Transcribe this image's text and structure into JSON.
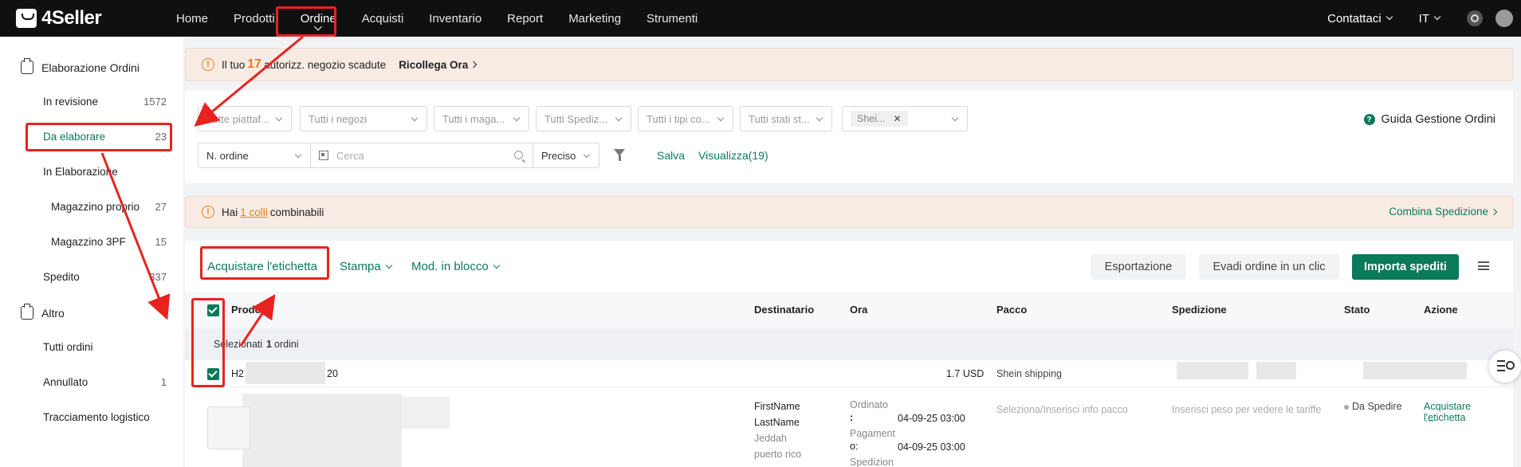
{
  "app": {
    "logo": "4Seller"
  },
  "nav": {
    "items": [
      {
        "label": "Home"
      },
      {
        "label": "Prodotti"
      },
      {
        "label": "Ordine"
      },
      {
        "label": "Acquisti"
      },
      {
        "label": "Inventario"
      },
      {
        "label": "Report"
      },
      {
        "label": "Marketing"
      },
      {
        "label": "Strumenti"
      }
    ],
    "contact": "Contattaci",
    "language": "IT"
  },
  "sidebar": {
    "group1": "Elaborazione Ordini",
    "items": [
      {
        "label": "In revisione",
        "count": "1572"
      },
      {
        "label": "Da elaborare",
        "count": "23"
      },
      {
        "label": "In Elaborazione",
        "count": ""
      },
      {
        "label": "Magazzino proprio",
        "count": "27"
      },
      {
        "label": "Magazzino 3PF",
        "count": "15"
      },
      {
        "label": "Spedito",
        "count": "337"
      }
    ],
    "group2": "Altro",
    "items2": [
      {
        "label": "Tutti ordini",
        "count": ""
      },
      {
        "label": "Annullato",
        "count": "1"
      },
      {
        "label": "Tracciamento logistico",
        "count": ""
      }
    ]
  },
  "alert1": {
    "prefix": "Il tuo",
    "count": "17",
    "suffix": "autorizz. negozio scadute",
    "link": "Ricollega Ora"
  },
  "filters": {
    "selects": [
      "Tutte piattaf...",
      "Tutti i negozi",
      "Tutti i maga...",
      "Tutti Spediz...",
      "Tutti i tipi co...",
      "Tutti stati st..."
    ],
    "tag": "Shei...",
    "order_type": "N. ordine",
    "search_placeholder": "Cerca",
    "match": "Preciso",
    "save": "Salva",
    "view": "Visualizza(19)",
    "guide": "Guida Gestione Ordini"
  },
  "alert2": {
    "prefix": "Hai",
    "link": "1 colli",
    "suffix": "combinabili",
    "action": "Combina Spedizione"
  },
  "actions": {
    "buy_label": "Acquistare l'etichetta",
    "print": "Stampa",
    "bulk": "Mod. in blocco",
    "export": "Esportazione",
    "fulfill": "Evadi ordine in un clic",
    "import": "Importa spediti"
  },
  "table": {
    "columns": [
      "Prodotti",
      "Destinatario",
      "Ora",
      "Pacco",
      "Spedizione",
      "Stato",
      "Azione"
    ],
    "selected_prefix": "Selezionati",
    "selected_count": "1",
    "selected_suffix": "ordini",
    "order": {
      "id_start": "H2",
      "id_end": "20",
      "amount": "1.7 USD",
      "shipping": "Shein shipping",
      "name_first": "FirstName",
      "name_last": "LastName",
      "city": "Jeddah",
      "region": "puerto rico",
      "ordered_label_1": "Ordinato",
      "ordered_label_2": ":",
      "ordered_time": "04-09-25 03:00",
      "paid_label_1": "Pagament",
      "paid_label_2": "o:",
      "paid_time": "04-09-25 03:00",
      "ship_label": "Spedizion",
      "package_hint": "Seleziona/Inserisci info pacco",
      "shipping_hint": "Inserisci peso per vedere le tariffe",
      "status": "Da Spedire",
      "action": "Acquistare l'etichetta",
      "more": "..."
    }
  },
  "colors": {
    "accent": "#0a7a5b",
    "warning": "#f07d10",
    "annotation": "#e8231f",
    "topbar": "#101010"
  }
}
